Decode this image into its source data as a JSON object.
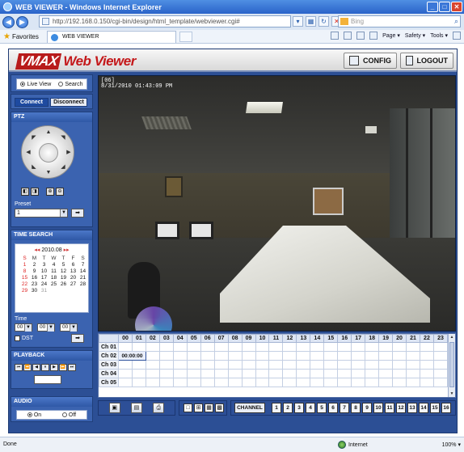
{
  "browser": {
    "title": "WEB VIEWER - Windows Internet Explorer",
    "url": "http://192.168.0.150/cgi-bin/design/html_template/webviewer.cgi#",
    "search_placeholder": "Bing",
    "favorites_label": "Favorites",
    "tab_title": "WEB VIEWER",
    "menu": [
      "Page ▾",
      "Safety ▾",
      "Tools ▾"
    ],
    "status_left": "Done",
    "status_zone": "Internet",
    "status_zoom": " 100% ▾"
  },
  "header": {
    "logo_mark": "VMAX",
    "logo_text": "Web Viewer",
    "config_label": "CONFIG",
    "logout_label": "LOGOUT"
  },
  "view_mode": {
    "live_label": "Live View",
    "search_label": "Search",
    "selected": "Live View"
  },
  "connection": {
    "connect_label": "Connect",
    "disconnect_label": "Disconnect"
  },
  "ptz": {
    "title": "PTZ",
    "preset_label": "Preset",
    "preset_value": "1"
  },
  "time_search": {
    "title": "TIME SEARCH",
    "calendar_header": "2010.08",
    "weekdays": [
      "S",
      "M",
      "T",
      "W",
      "T",
      "F",
      "S"
    ],
    "days": [
      "1",
      "2",
      "3",
      "4",
      "5",
      "6",
      "7",
      "8",
      "9",
      "10",
      "11",
      "12",
      "13",
      "14",
      "15",
      "16",
      "17",
      "18",
      "19",
      "20",
      "21",
      "22",
      "23",
      "24",
      "25",
      "26",
      "27",
      "28",
      "29",
      "30",
      "31"
    ],
    "time_label": "Time",
    "hour": "00",
    "minute": "00",
    "second": "00",
    "dst_label": "DST"
  },
  "playback": {
    "title": "PLAYBACK"
  },
  "audio": {
    "title": "AUDIO",
    "on_label": "On",
    "off_label": "Off",
    "selected": "On"
  },
  "video": {
    "channel_tag": "[06]",
    "timestamp": "8/31/2010 01:43:09 PM"
  },
  "timeline": {
    "hours": [
      "00",
      "01",
      "02",
      "03",
      "04",
      "05",
      "06",
      "07",
      "08",
      "09",
      "10",
      "11",
      "12",
      "13",
      "14",
      "15",
      "16",
      "17",
      "18",
      "19",
      "20",
      "21",
      "22",
      "23"
    ],
    "channels": [
      "Ch 01",
      "Ch 02",
      "Ch 03",
      "Ch 04",
      "Ch 05"
    ],
    "selected_time": "00:00:00"
  },
  "channels": {
    "label": "CHANNEL",
    "buttons": [
      "1",
      "2",
      "3",
      "4",
      "5",
      "6",
      "7",
      "8",
      "9",
      "10",
      "11",
      "12",
      "13",
      "14",
      "15",
      "16"
    ]
  },
  "colors": {
    "frame": "#2c4f95",
    "panel": "#3b63b0",
    "brand_red": "#c4181a"
  }
}
